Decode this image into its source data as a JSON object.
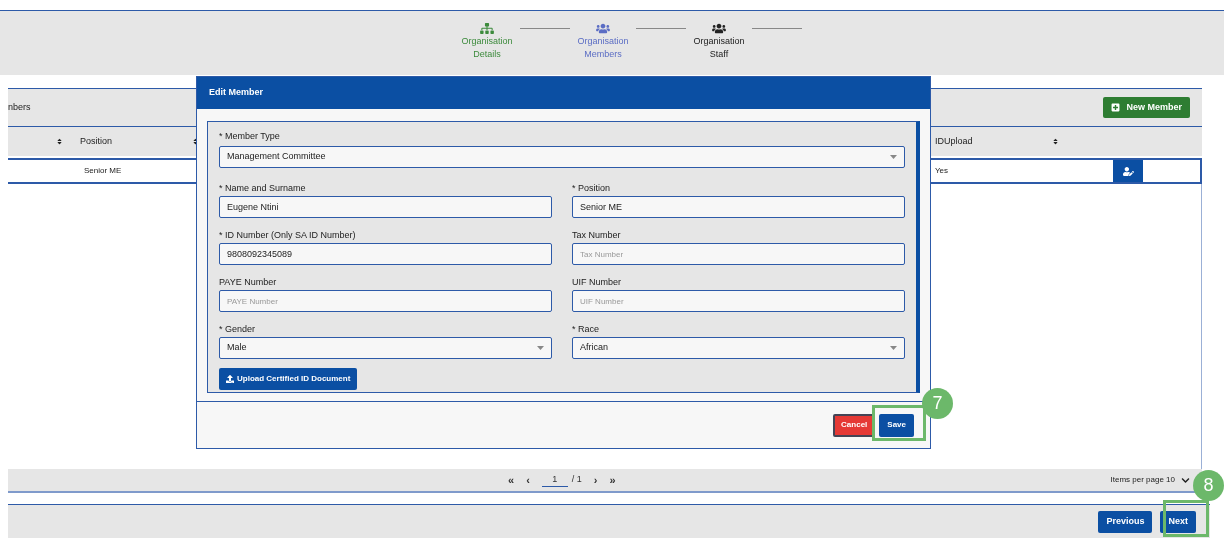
{
  "steps": [
    {
      "line1": "Organisation",
      "line2": "Details",
      "done": true,
      "selected": false
    },
    {
      "line1": "Organisation",
      "line2": "Members",
      "done": false,
      "selected": true
    },
    {
      "line1": "Organisation",
      "line2": "Staff",
      "done": false,
      "selected": false
    }
  ],
  "panel": {
    "title": "nbers",
    "new_button": "New Member"
  },
  "table": {
    "columns": [
      "Position",
      "IDUpload"
    ],
    "row": {
      "position": "Senior ME",
      "id_upload": "Yes"
    }
  },
  "pagination": {
    "first": "«",
    "prev": "‹",
    "page": "1",
    "total": "/ 1",
    "next": "›",
    "last": "»",
    "items_label": "Items per page 10"
  },
  "footer": {
    "previous": "Previous",
    "next": "Next"
  },
  "modal": {
    "title": "Edit Member",
    "member_type": {
      "label": "* Member Type",
      "value": "Management Committee"
    },
    "fields": [
      {
        "label": "* Name and Surname",
        "kind": "text",
        "value": "Eugene Ntini"
      },
      {
        "label": "* Position",
        "kind": "text",
        "value": "Senior ME"
      },
      {
        "label": "* ID Number (Only SA ID Number)",
        "kind": "text",
        "value": "9808092345089"
      },
      {
        "label": "Tax Number",
        "kind": "text",
        "placeholder": "Tax Number"
      },
      {
        "label": "PAYE Number",
        "kind": "text",
        "placeholder": "PAYE Number"
      },
      {
        "label": "UIF Number",
        "kind": "text",
        "placeholder": "UIF Number"
      },
      {
        "label": "* Gender",
        "kind": "select",
        "value": "Male"
      },
      {
        "label": "* Race",
        "kind": "select",
        "value": "African"
      }
    ],
    "upload_button": "Upload Certified ID Document",
    "cancel": "Cancel",
    "save": "Save"
  },
  "annotations": [
    "7",
    "8"
  ]
}
